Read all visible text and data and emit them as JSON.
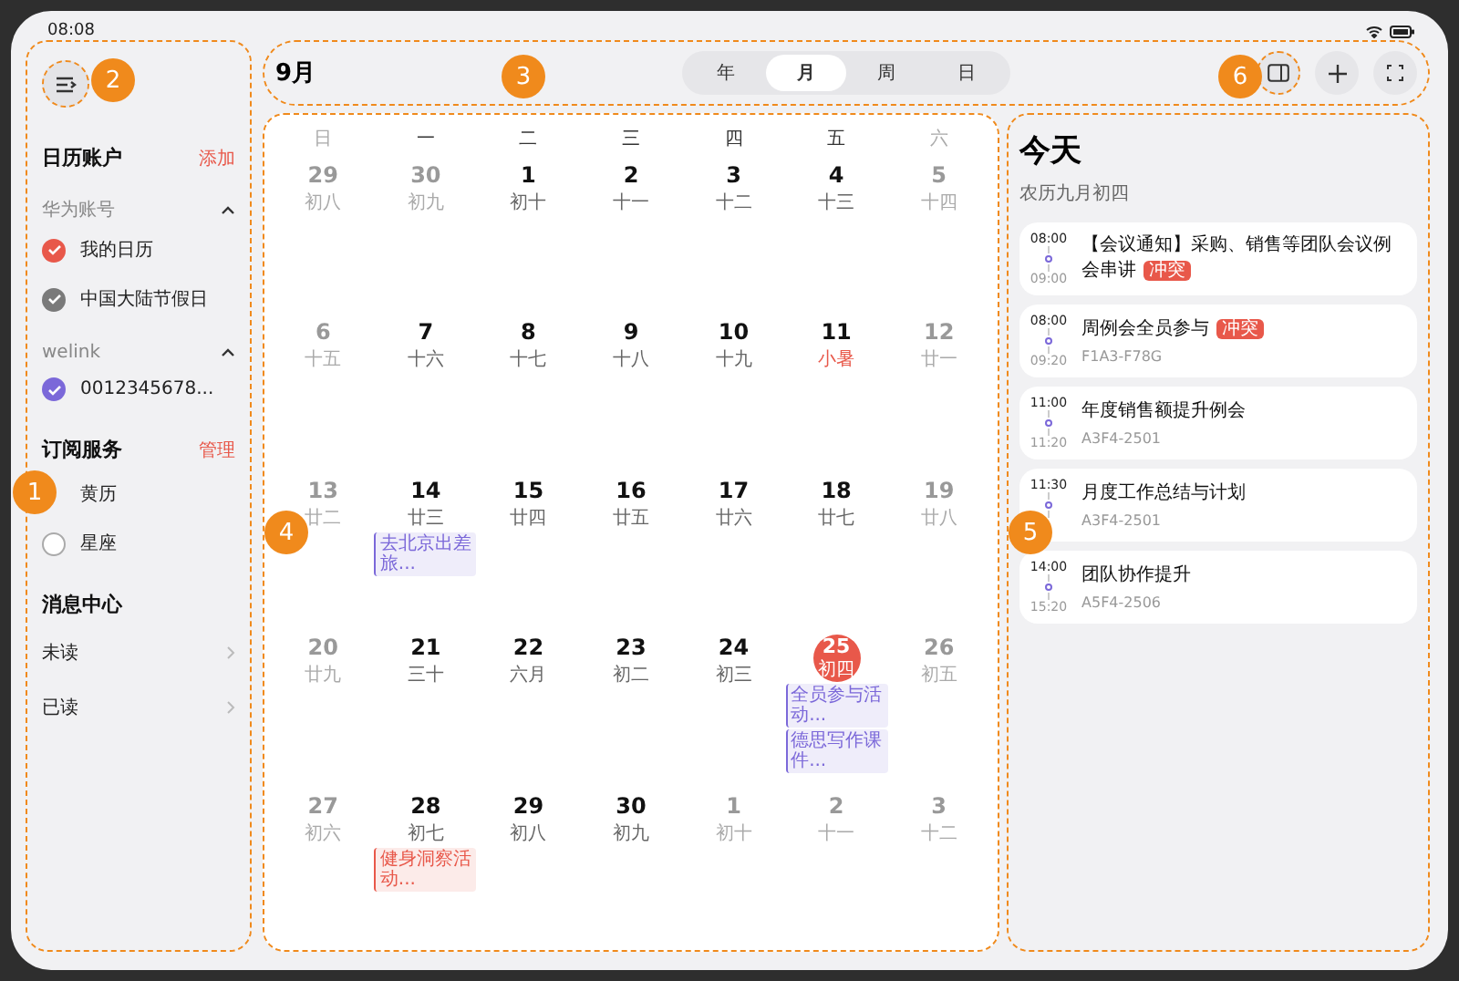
{
  "status_bar": {
    "time": "08:08"
  },
  "sidebar": {
    "accounts": {
      "title": "日历账户",
      "action": "添加",
      "groups": [
        {
          "name": "华为账号",
          "expanded": true,
          "items": [
            {
              "label": "我的日历",
              "checked": true,
              "color": "#e8584a"
            },
            {
              "label": "中国大陆节假日",
              "checked": true,
              "color": "#7a7a7a"
            }
          ]
        },
        {
          "name": "welink",
          "expanded": true,
          "items": [
            {
              "label": "0012345678...",
              "checked": true,
              "color": "#7b68d9"
            }
          ]
        }
      ]
    },
    "subscriptions": {
      "title": "订阅服务",
      "action": "管理",
      "items": [
        {
          "label": "黄历"
        },
        {
          "label": "星座",
          "checked": false
        }
      ]
    },
    "messages": {
      "title": "消息中心",
      "items": [
        {
          "label": "未读"
        },
        {
          "label": "已读"
        }
      ]
    }
  },
  "toolbar": {
    "month": "9月",
    "views": [
      {
        "label": "年",
        "selected": false
      },
      {
        "label": "月",
        "selected": true
      },
      {
        "label": "周",
        "selected": false
      },
      {
        "label": "日",
        "selected": false
      }
    ]
  },
  "calendar": {
    "weekdays": [
      {
        "label": "日",
        "weekend": true
      },
      {
        "label": "一",
        "weekend": false
      },
      {
        "label": "二",
        "weekend": false
      },
      {
        "label": "三",
        "weekend": false
      },
      {
        "label": "四",
        "weekend": false
      },
      {
        "label": "五",
        "weekend": false
      },
      {
        "label": "六",
        "weekend": true
      }
    ],
    "weeks": [
      [
        {
          "day": "29",
          "lunar": "初八",
          "muted": true
        },
        {
          "day": "30",
          "lunar": "初九",
          "muted": true
        },
        {
          "day": "1",
          "lunar": "初十",
          "muted": false
        },
        {
          "day": "2",
          "lunar": "十一",
          "muted": false
        },
        {
          "day": "3",
          "lunar": "十二",
          "muted": false
        },
        {
          "day": "4",
          "lunar": "十三",
          "muted": false
        },
        {
          "day": "5",
          "lunar": "十四",
          "muted": true
        }
      ],
      [
        {
          "day": "6",
          "lunar": "十五",
          "muted": true
        },
        {
          "day": "7",
          "lunar": "十六",
          "muted": false
        },
        {
          "day": "8",
          "lunar": "十七",
          "muted": false
        },
        {
          "day": "9",
          "lunar": "十八",
          "muted": false
        },
        {
          "day": "10",
          "lunar": "十九",
          "muted": false
        },
        {
          "day": "11",
          "lunar": "小暑",
          "muted": false,
          "festival": true
        },
        {
          "day": "12",
          "lunar": "廿一",
          "muted": true
        }
      ],
      [
        {
          "day": "13",
          "lunar": "廿二",
          "muted": true
        },
        {
          "day": "14",
          "lunar": "廿三",
          "muted": false,
          "events": [
            {
              "title": "去北京出差旅...",
              "color": "#7b68d9"
            }
          ]
        },
        {
          "day": "15",
          "lunar": "廿四",
          "muted": false
        },
        {
          "day": "16",
          "lunar": "廿五",
          "muted": false
        },
        {
          "day": "17",
          "lunar": "廿六",
          "muted": false
        },
        {
          "day": "18",
          "lunar": "廿七",
          "muted": false
        },
        {
          "day": "19",
          "lunar": "廿八",
          "muted": true
        }
      ],
      [
        {
          "day": "20",
          "lunar": "廿九",
          "muted": true
        },
        {
          "day": "21",
          "lunar": "三十",
          "muted": false
        },
        {
          "day": "22",
          "lunar": "六月",
          "muted": false
        },
        {
          "day": "23",
          "lunar": "初二",
          "muted": false
        },
        {
          "day": "24",
          "lunar": "初三",
          "muted": false
        },
        {
          "day": "25",
          "lunar": "初四",
          "today": true,
          "events": [
            {
              "title": "全员参与活动...",
              "color": "#7b68d9"
            },
            {
              "title": "德思写作课件...",
              "color": "#7b68d9"
            }
          ]
        },
        {
          "day": "26",
          "lunar": "初五",
          "muted": true
        }
      ],
      [
        {
          "day": "27",
          "lunar": "初六",
          "muted": true
        },
        {
          "day": "28",
          "lunar": "初七",
          "muted": false,
          "events": [
            {
              "title": "健身洞察活动...",
              "color": "#e8584a"
            }
          ]
        },
        {
          "day": "29",
          "lunar": "初八",
          "muted": false
        },
        {
          "day": "30",
          "lunar": "初九",
          "muted": false
        },
        {
          "day": "1",
          "lunar": "初十",
          "muted": true
        },
        {
          "day": "2",
          "lunar": "十一",
          "muted": true
        },
        {
          "day": "3",
          "lunar": "十二",
          "muted": true
        }
      ]
    ]
  },
  "today": {
    "title": "今天",
    "subtitle": "农历九月初四",
    "agenda": [
      {
        "start": "08:00",
        "end": "09:00",
        "title": "【会议通知】采购、销售等团队会议例会串讲",
        "tag": "冲突"
      },
      {
        "start": "08:00",
        "end": "09:20",
        "title": "周例会全员参与",
        "tag": "冲突",
        "location": "F1A3-F78G"
      },
      {
        "start": "11:00",
        "end": "11:20",
        "title": "年度销售额提升例会",
        "location": "A3F4-2501"
      },
      {
        "start": "11:30",
        "title": "月度工作总结与计划",
        "location": "A3F4-2501"
      },
      {
        "start": "14:00",
        "end": "15:20",
        "title": "团队协作提升",
        "location": "A5F4-2506"
      }
    ]
  },
  "callouts": [
    {
      "label": "1"
    },
    {
      "label": "2"
    },
    {
      "label": "3"
    },
    {
      "label": "4"
    },
    {
      "label": "5"
    },
    {
      "label": "6"
    }
  ]
}
